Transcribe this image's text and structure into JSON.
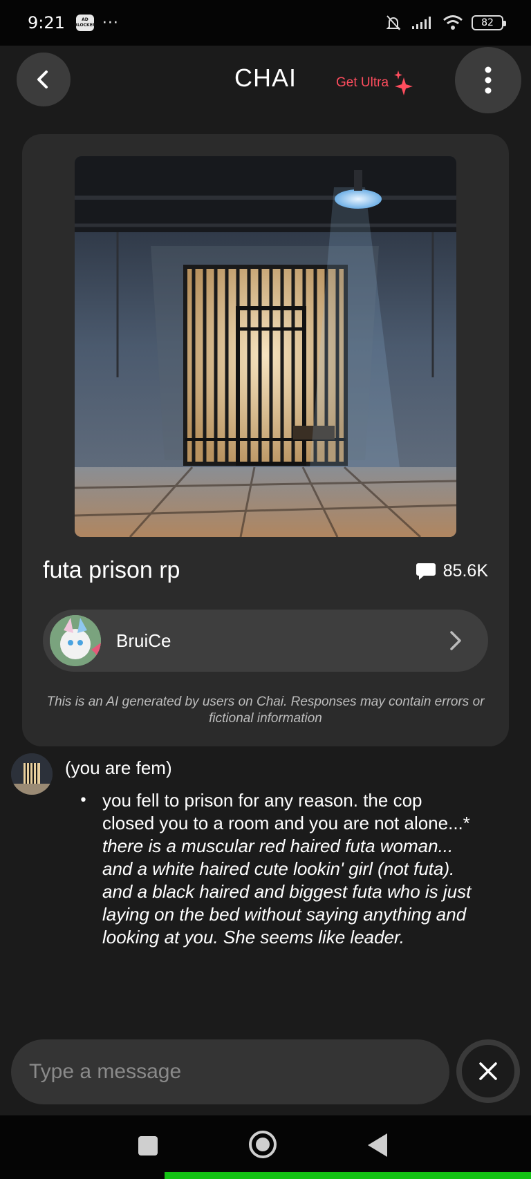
{
  "status_bar": {
    "time": "9:21",
    "adblock_label": "AD BLOCKER",
    "more": "···",
    "battery": "82"
  },
  "header": {
    "title": "CHAI",
    "get_ultra": "Get Ultra"
  },
  "bot": {
    "name": "futa prison rp",
    "message_count": "85.6K",
    "creator": "BruiCe",
    "disclaimer": "This is an AI generated by users on Chai. Responses may contain errors or fictional information"
  },
  "message": {
    "first_line": "(you are fem)",
    "bullet": "•",
    "text_plain": "you fell to prison for any reason. the cop closed you to a room and you are not alone...*",
    "text_italic": " there is a muscular red haired futa woman... and a white haired cute lookin' girl (not futa). and a black haired and biggest futa who is just laying on the bed  without saying anything and looking at you. She seems like leader."
  },
  "input": {
    "placeholder": "Type a message"
  },
  "colors": {
    "accent": "#ff4d5e",
    "background": "#1b1b1b",
    "card": "#2b2b2b",
    "nav_indicator": "#13c213"
  }
}
